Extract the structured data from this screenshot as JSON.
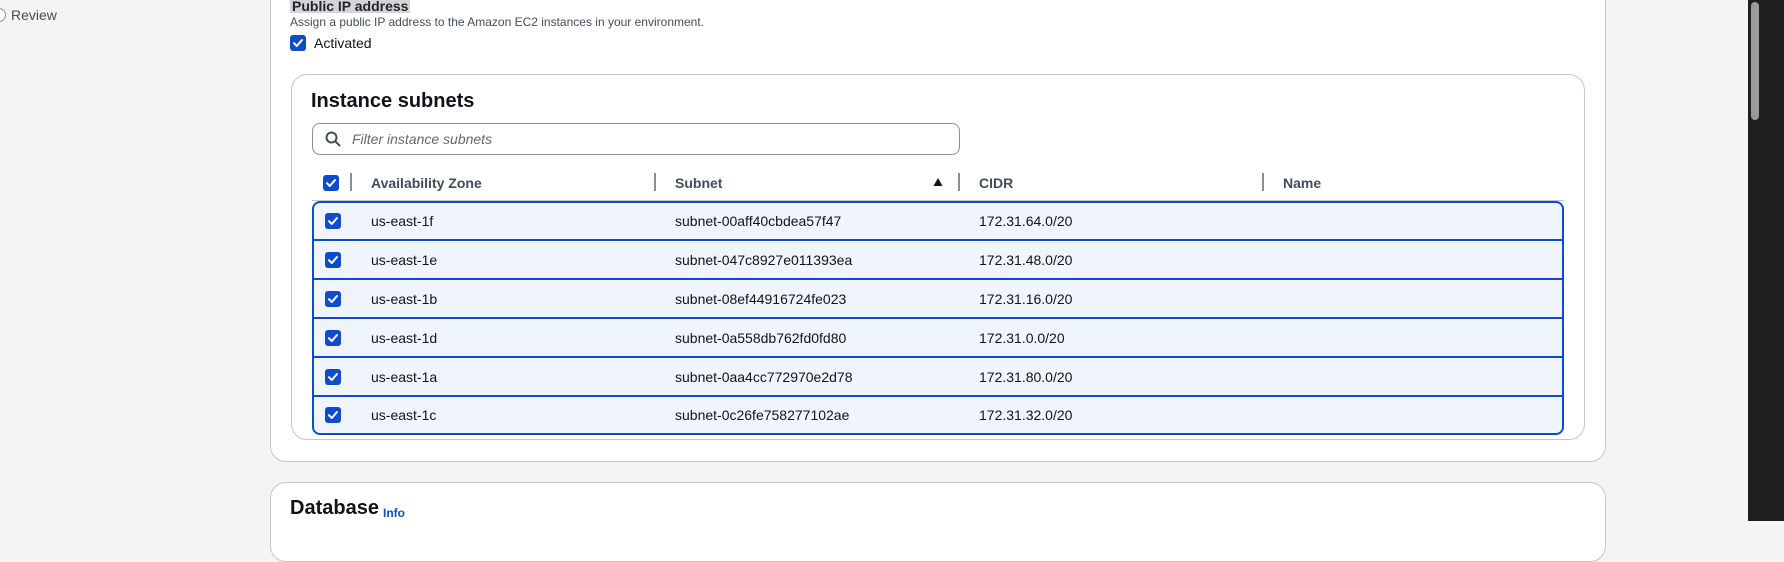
{
  "nav": {
    "steps": [
      {
        "label": "Review"
      }
    ]
  },
  "public_ip": {
    "label": "Public IP address",
    "description": "Assign a public IP address to the Amazon EC2 instances in your environment.",
    "checkbox_label": "Activated",
    "checked": true
  },
  "subnets": {
    "title": "Instance subnets",
    "filter_placeholder": "Filter instance subnets",
    "columns": [
      "Availability Zone",
      "Subnet",
      "CIDR",
      "Name"
    ],
    "sorted_column": "Subnet",
    "sort_direction": "ascending",
    "rows": [
      {
        "az": "us-east-1f",
        "subnet": "subnet-00aff40cbdea57f47",
        "cidr": "172.31.64.0/20",
        "name": "",
        "selected": true
      },
      {
        "az": "us-east-1e",
        "subnet": "subnet-047c8927e011393ea",
        "cidr": "172.31.48.0/20",
        "name": "",
        "selected": true
      },
      {
        "az": "us-east-1b",
        "subnet": "subnet-08ef44916724fe023",
        "cidr": "172.31.16.0/20",
        "name": "",
        "selected": true
      },
      {
        "az": "us-east-1d",
        "subnet": "subnet-0a558db762fd0fd80",
        "cidr": "172.31.0.0/20",
        "name": "",
        "selected": true
      },
      {
        "az": "us-east-1a",
        "subnet": "subnet-0aa4cc772970e2d78",
        "cidr": "172.31.80.0/20",
        "name": "",
        "selected": true
      },
      {
        "az": "us-east-1c",
        "subnet": "subnet-0c26fe758277102ae",
        "cidr": "172.31.32.0/20",
        "name": "",
        "selected": true
      }
    ]
  },
  "database": {
    "title": "Database",
    "info_link": "Info"
  },
  "colors": {
    "accent": "#0f4ccb",
    "selected_row_bg": "#f0f5fd"
  }
}
